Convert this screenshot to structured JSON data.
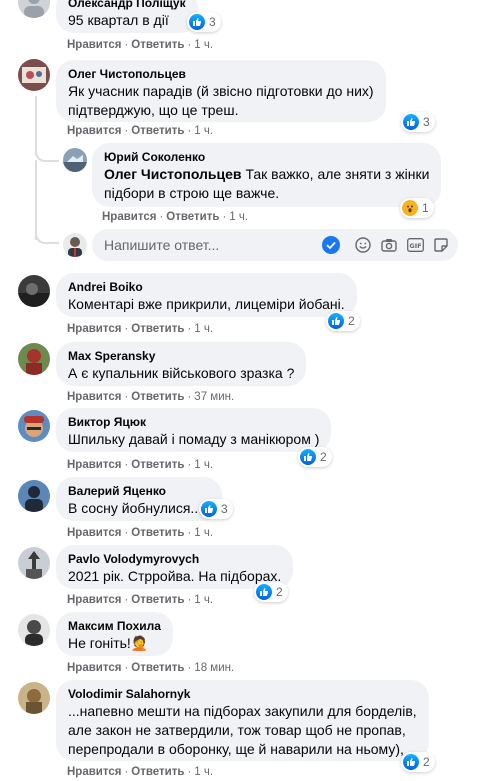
{
  "actions": {
    "like": "Нравится",
    "reply": "Ответить",
    "dot": "·"
  },
  "colors": {
    "bubble": "#f0f2f5",
    "meta": "#65676b",
    "like_blue": "#1877f2",
    "wow_yellow": "#f7b125"
  },
  "reply_box": {
    "placeholder": "Напишите ответ..."
  },
  "comments": [
    {
      "author": "Олександр Поліщук",
      "text": "95 квартал в дії",
      "time": "1 ч.",
      "reactions": "3",
      "reaction_type": "like"
    },
    {
      "author": "Олег Чистопольцев",
      "lines": [
        "Як учасник парадів (й звісно підготовки до них)",
        "підтверджую, що це треш."
      ],
      "time": "1 ч.",
      "reactions": "3",
      "reaction_type": "like"
    },
    {
      "author": "Юрий Соколенко",
      "mention": "Олег Чистопольцев",
      "lines": [
        "Так важко, але зняти з жінки",
        "підбори в строю ще важче."
      ],
      "time": "1 ч.",
      "reactions": "1",
      "reaction_type": "wow"
    },
    {
      "author": "Andrei Boiko",
      "text": "Коментарі вже прикрили, лицеміри йобані.",
      "time": "1 ч.",
      "reactions": "2",
      "reaction_type": "like"
    },
    {
      "author": "Max Speransky",
      "text": "А є купальник військового зразка ?",
      "time": "37 мин."
    },
    {
      "author": "Виктор Яцюк",
      "text": "Шпильку давай і помаду з манікюром )",
      "time": "1 ч.",
      "reactions": "2",
      "reaction_type": "like"
    },
    {
      "author": "Валерий Яценко",
      "text": "В сосну йобнулися.....",
      "time": "1 ч.",
      "reactions": "3",
      "reaction_type": "like"
    },
    {
      "author": "Pavlo Volodymyrovych",
      "text": "2021 рік. Стрройва. На підборах.",
      "time": "1 ч.",
      "reactions": "2",
      "reaction_type": "like"
    },
    {
      "author": "Максим Похила",
      "text": "Не гоніть!",
      "emoji": "🤦",
      "time": "18 мин."
    },
    {
      "author": "Volodimir Salahornyk",
      "lines": [
        "...напевно мешти на підборах закупили для борделів,",
        "але закон не затвердили, тож товар щоб не пропав,",
        "перепродали в оборонку, ще й наварили на ньому),"
      ],
      "time": "1 ч.",
      "reactions": "2",
      "reaction_type": "like"
    }
  ]
}
